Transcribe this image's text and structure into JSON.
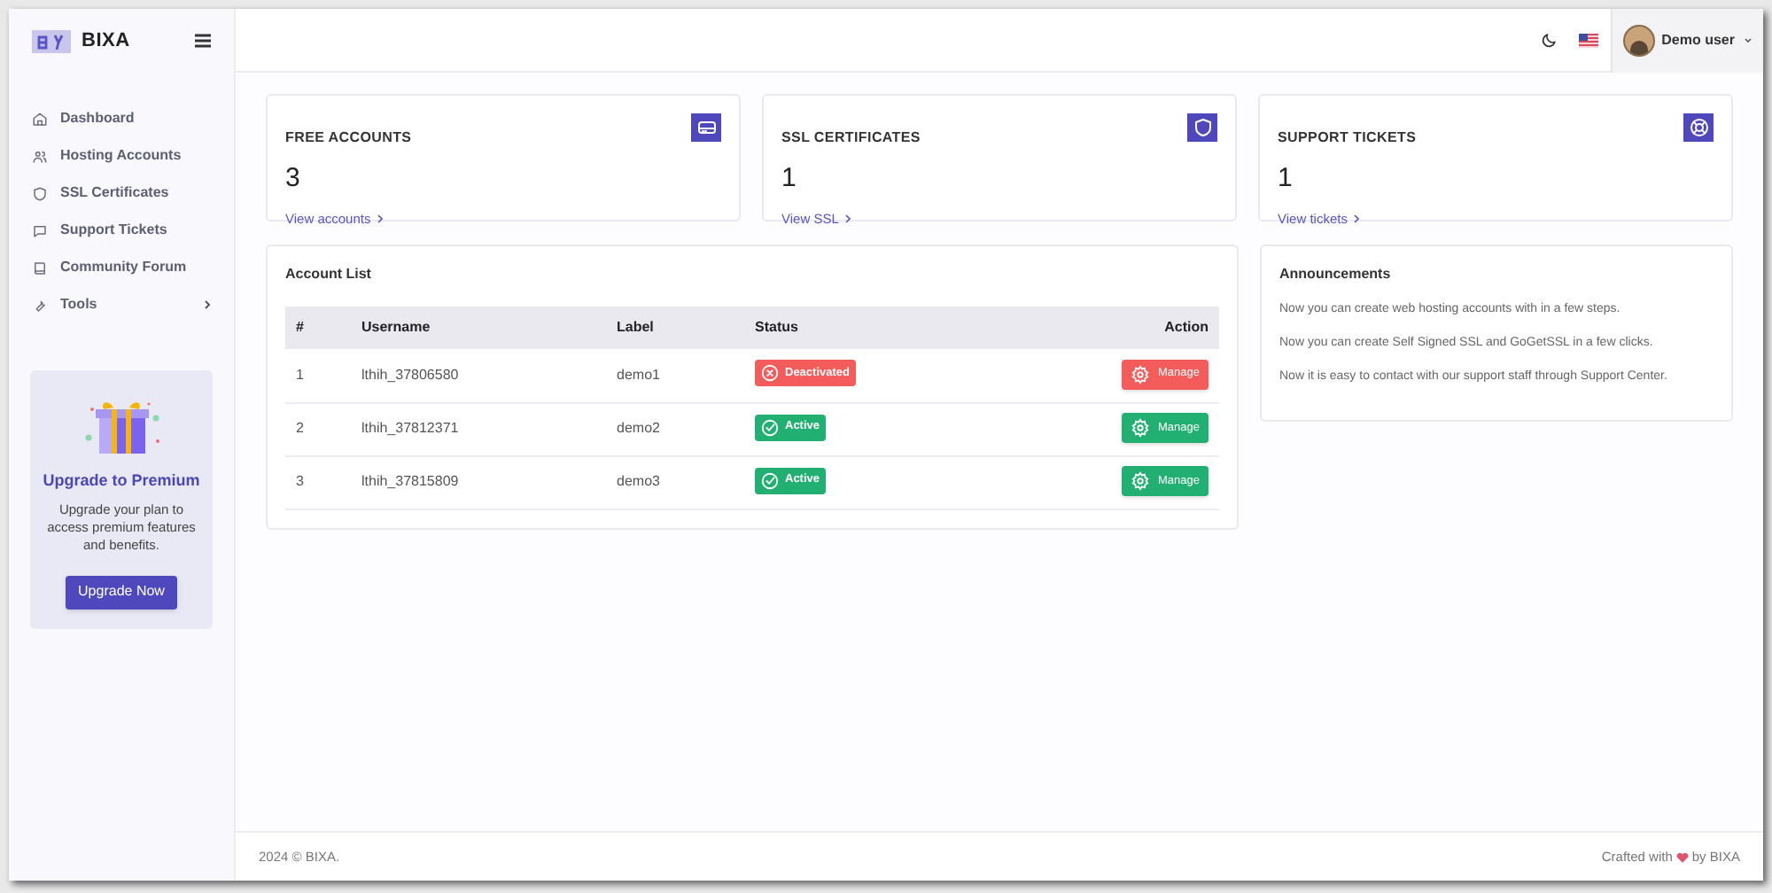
{
  "sidebar": {
    "brand": "BIXA",
    "items": [
      {
        "label": "Dashboard",
        "has_submenu": false
      },
      {
        "label": "Hosting Accounts",
        "has_submenu": false
      },
      {
        "label": "SSL Certificates",
        "has_submenu": false
      },
      {
        "label": "Support Tickets",
        "has_submenu": false
      },
      {
        "label": "Community Forum",
        "has_submenu": false
      },
      {
        "label": "Tools",
        "has_submenu": true
      }
    ],
    "promo": {
      "title": "Upgrade to Premium",
      "text": "Upgrade your plan to access premium features and benefits.",
      "button": "Upgrade Now"
    }
  },
  "header": {
    "user": "Demo user"
  },
  "stats": [
    {
      "title": "FREE ACCOUNTS",
      "value": "3",
      "link": "View accounts"
    },
    {
      "title": "SSL CERTIFICATES",
      "value": "1",
      "link": "View SSL"
    },
    {
      "title": "SUPPORT TICKETS",
      "value": "1",
      "link": "View tickets"
    }
  ],
  "account_list": {
    "title": "Account List",
    "columns": [
      "#",
      "Username",
      "Label",
      "Status",
      "Action"
    ],
    "rows": [
      {
        "number": "1",
        "username": "lthih_37806580",
        "label": "demo1",
        "status": {
          "kind": "deactivated",
          "text": "Deactivated"
        },
        "action": "Manage"
      },
      {
        "number": "2",
        "username": "lthih_37812371",
        "label": "demo2",
        "status": {
          "kind": "active",
          "text": "Active"
        },
        "action": "Manage"
      },
      {
        "number": "3",
        "username": "lthih_37815809",
        "label": "demo3",
        "status": {
          "kind": "active",
          "text": "Active"
        },
        "action": "Manage"
      }
    ]
  },
  "announcements": {
    "title": "Announcements",
    "items": [
      "Now you can create web hosting accounts with in a few steps.",
      "Now you can create Self Signed SSL and GoGetSSL in a few clicks.",
      "Now it is easy to contact with our support staff through Support Center."
    ]
  },
  "footer": {
    "copyright": "2024 © BIXA.",
    "credit_before": "Crafted with",
    "credit_after": "by BIXA"
  }
}
